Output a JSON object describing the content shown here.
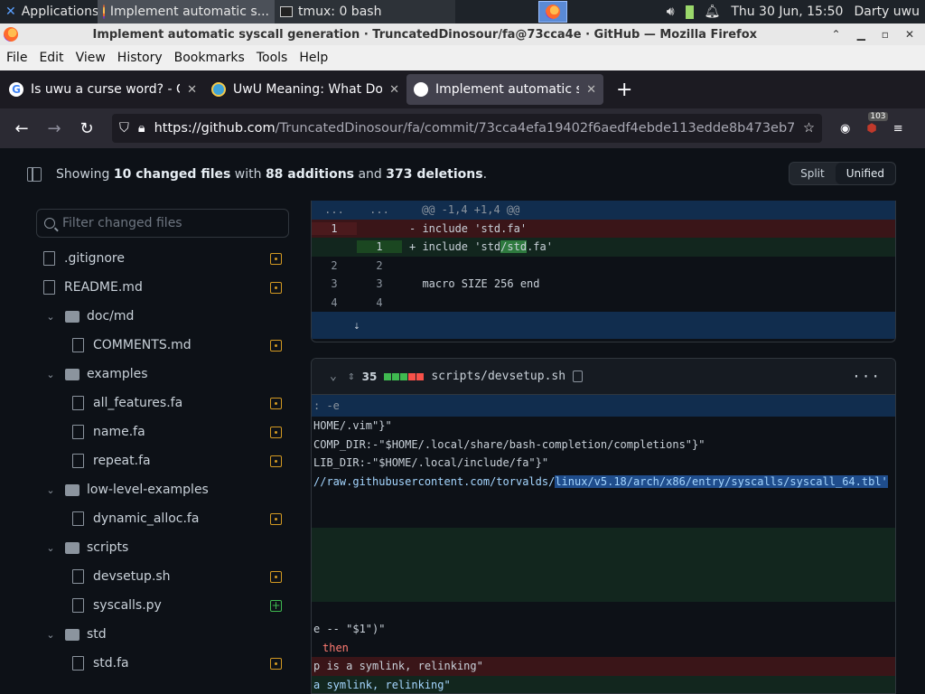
{
  "taskbar": {
    "applications": "Applications",
    "win1": "Implement automatic s...",
    "win2": "tmux: 0 bash",
    "datetime": "Thu 30 Jun, 15:50",
    "user": "Darty uwu"
  },
  "titlebar": {
    "title": "Implement automatic syscall generation · TruncatedDinosour/fa@73cca4e · GitHub — Mozilla Firefox"
  },
  "menu": [
    "File",
    "Edit",
    "View",
    "History",
    "Bookmarks",
    "Tools",
    "Help"
  ],
  "tabs": [
    {
      "label": "Is uwu a curse word? - Go"
    },
    {
      "label": "UwU Meaning: What Doe"
    },
    {
      "label": "Implement automatic sys"
    }
  ],
  "nav": {
    "url_host": "https://github.com",
    "url_path": "/TruncatedDinosour/fa/commit/73cca4efa19402f6aedf4ebde113edde8b473eb7",
    "badge_count": "103"
  },
  "summary": {
    "prefix": "Showing ",
    "files": "10 changed files",
    "with": " with ",
    "additions": "88 additions",
    "and": " and ",
    "deletions": "373 deletions",
    "end": ".",
    "split": "Split",
    "unified": "Unified"
  },
  "filter": {
    "placeholder": "Filter changed files"
  },
  "tree": [
    {
      "name": ".gitignore",
      "status": "modified"
    },
    {
      "name": "README.md",
      "status": "modified"
    },
    {
      "name": "doc/md"
    },
    {
      "name": "COMMENTS.md",
      "status": "modified"
    },
    {
      "name": "examples"
    },
    {
      "name": "all_features.fa",
      "status": "modified"
    },
    {
      "name": "name.fa",
      "status": "modified"
    },
    {
      "name": "repeat.fa",
      "status": "modified"
    },
    {
      "name": "low-level-examples"
    },
    {
      "name": "dynamic_alloc.fa",
      "status": "modified"
    },
    {
      "name": "scripts"
    },
    {
      "name": "devsetup.sh",
      "status": "modified"
    },
    {
      "name": "syscalls.py",
      "status": "added"
    },
    {
      "name": "std"
    },
    {
      "name": "std.fa",
      "status": "modified"
    }
  ],
  "diff1": {
    "hunk_l": "...",
    "hunk_r": "...",
    "hunk": "@@ -1,4 +1,4 @@",
    "rows": [
      {
        "old": "1",
        "new": "",
        "sign": "-",
        "pre": " include 'std",
        "mid": "",
        "post": ".fa'"
      },
      {
        "old": "",
        "new": "1",
        "sign": "+",
        "pre": " include 'std",
        "mid": "/std",
        "post": ".fa'"
      },
      {
        "old": "2",
        "new": "2",
        "text": ""
      },
      {
        "old": "3",
        "new": "3",
        "text": "  macro SIZE 256 end"
      },
      {
        "old": "4",
        "new": "4",
        "text": ""
      }
    ],
    "expand": "⇣"
  },
  "diff2": {
    "count": "35",
    "filename": "scripts/devsetup.sh",
    "lines": {
      "l1": ": -e",
      "l2": "HOME/.vim\"}\"",
      "l3": "COMP_DIR:-\"$HOME/.local/share/bash-completion/completions\"}\"",
      "l4": "LIB_DIR:-\"$HOME/.local/include/fa\"}\"",
      "l5_pre": "//raw.githubusercontent.com/torvalds/",
      "l5_sel": "linux/v5.18/arch/x86/entry/syscalls/syscall_64.tbl'",
      "l6": "e -- \"$1\")\"",
      "l7": "then",
      "l8": "p is a symlink, relinking\"",
      "l9": "a symlink, relinking\""
    }
  }
}
